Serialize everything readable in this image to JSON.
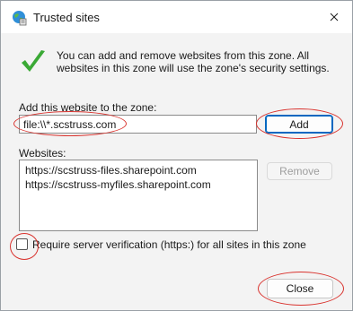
{
  "window": {
    "title": "Trusted sites"
  },
  "info": {
    "message": "You can add and remove websites from this zone. All websites in this zone will use the zone's security settings."
  },
  "add_section": {
    "label": "Add this website to the zone:",
    "input_value": "file:\\\\*.scstruss.com",
    "add_label": "Add"
  },
  "websites": {
    "label": "Websites:",
    "items": [
      "https://scstruss-files.sharepoint.com",
      "https://scstruss-myfiles.sharepoint.com"
    ],
    "remove_label": "Remove"
  },
  "verification": {
    "label": "Require server verification (https:) for all sites in this zone",
    "checked": false
  },
  "footer": {
    "close_label": "Close"
  },
  "colors": {
    "accent": "#0067c0",
    "annotation": "#d9332e",
    "check": "#3aa935"
  },
  "icons": {
    "app": "globe-security-icon",
    "info": "green-checkmark-icon",
    "window_close": "close-icon"
  }
}
